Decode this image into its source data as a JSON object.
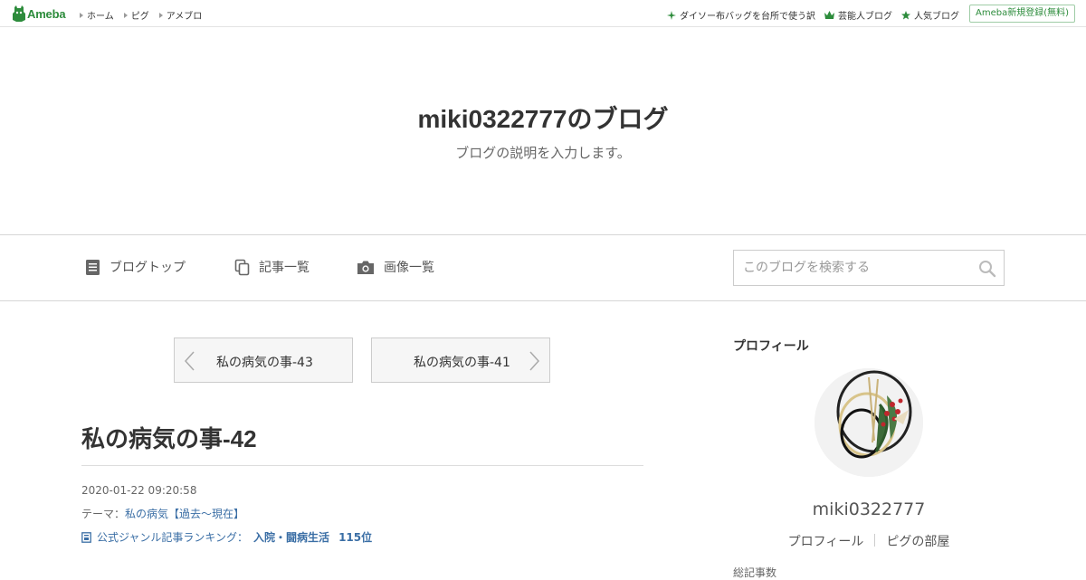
{
  "topbar": {
    "logo_text": "Ameba",
    "nav": [
      "ホーム",
      "ピグ",
      "アメブロ"
    ],
    "links": [
      {
        "icon": "sparkle-icon",
        "label": "ダイソー布バッグを台所で使う訳"
      },
      {
        "icon": "crown-icon",
        "label": "芸能人ブログ"
      },
      {
        "icon": "star-icon",
        "label": "人気ブログ"
      }
    ],
    "register_label": "Ameba新規登録(無料)"
  },
  "header": {
    "title": "miki0322777のブログ",
    "description": "ブログの説明を入力します。"
  },
  "menu": {
    "items": [
      "ブログトップ",
      "記事一覧",
      "画像一覧"
    ],
    "search_placeholder": "このブログを検索する"
  },
  "pager": {
    "prev_label": "私の病気の事-43",
    "next_label": "私の病気の事-41"
  },
  "entry": {
    "title": "私の病気の事-42",
    "date": "2020-01-22 09:20:58",
    "theme_prefix": "テーマ：",
    "theme": "私の病気【過去～現在】",
    "ranking_prefix": "公式ジャンル記事ランキング：",
    "ranking_genre": "入院・闘病生活",
    "ranking_rank": "115位"
  },
  "sidebar": {
    "heading": "プロフィール",
    "name": "miki0322777",
    "links": [
      "プロフィール",
      "ピグの部屋"
    ],
    "cut_text": "総記事数"
  },
  "colors": {
    "brand_green": "#2d8c3c",
    "link_blue": "#3a6ea5"
  }
}
